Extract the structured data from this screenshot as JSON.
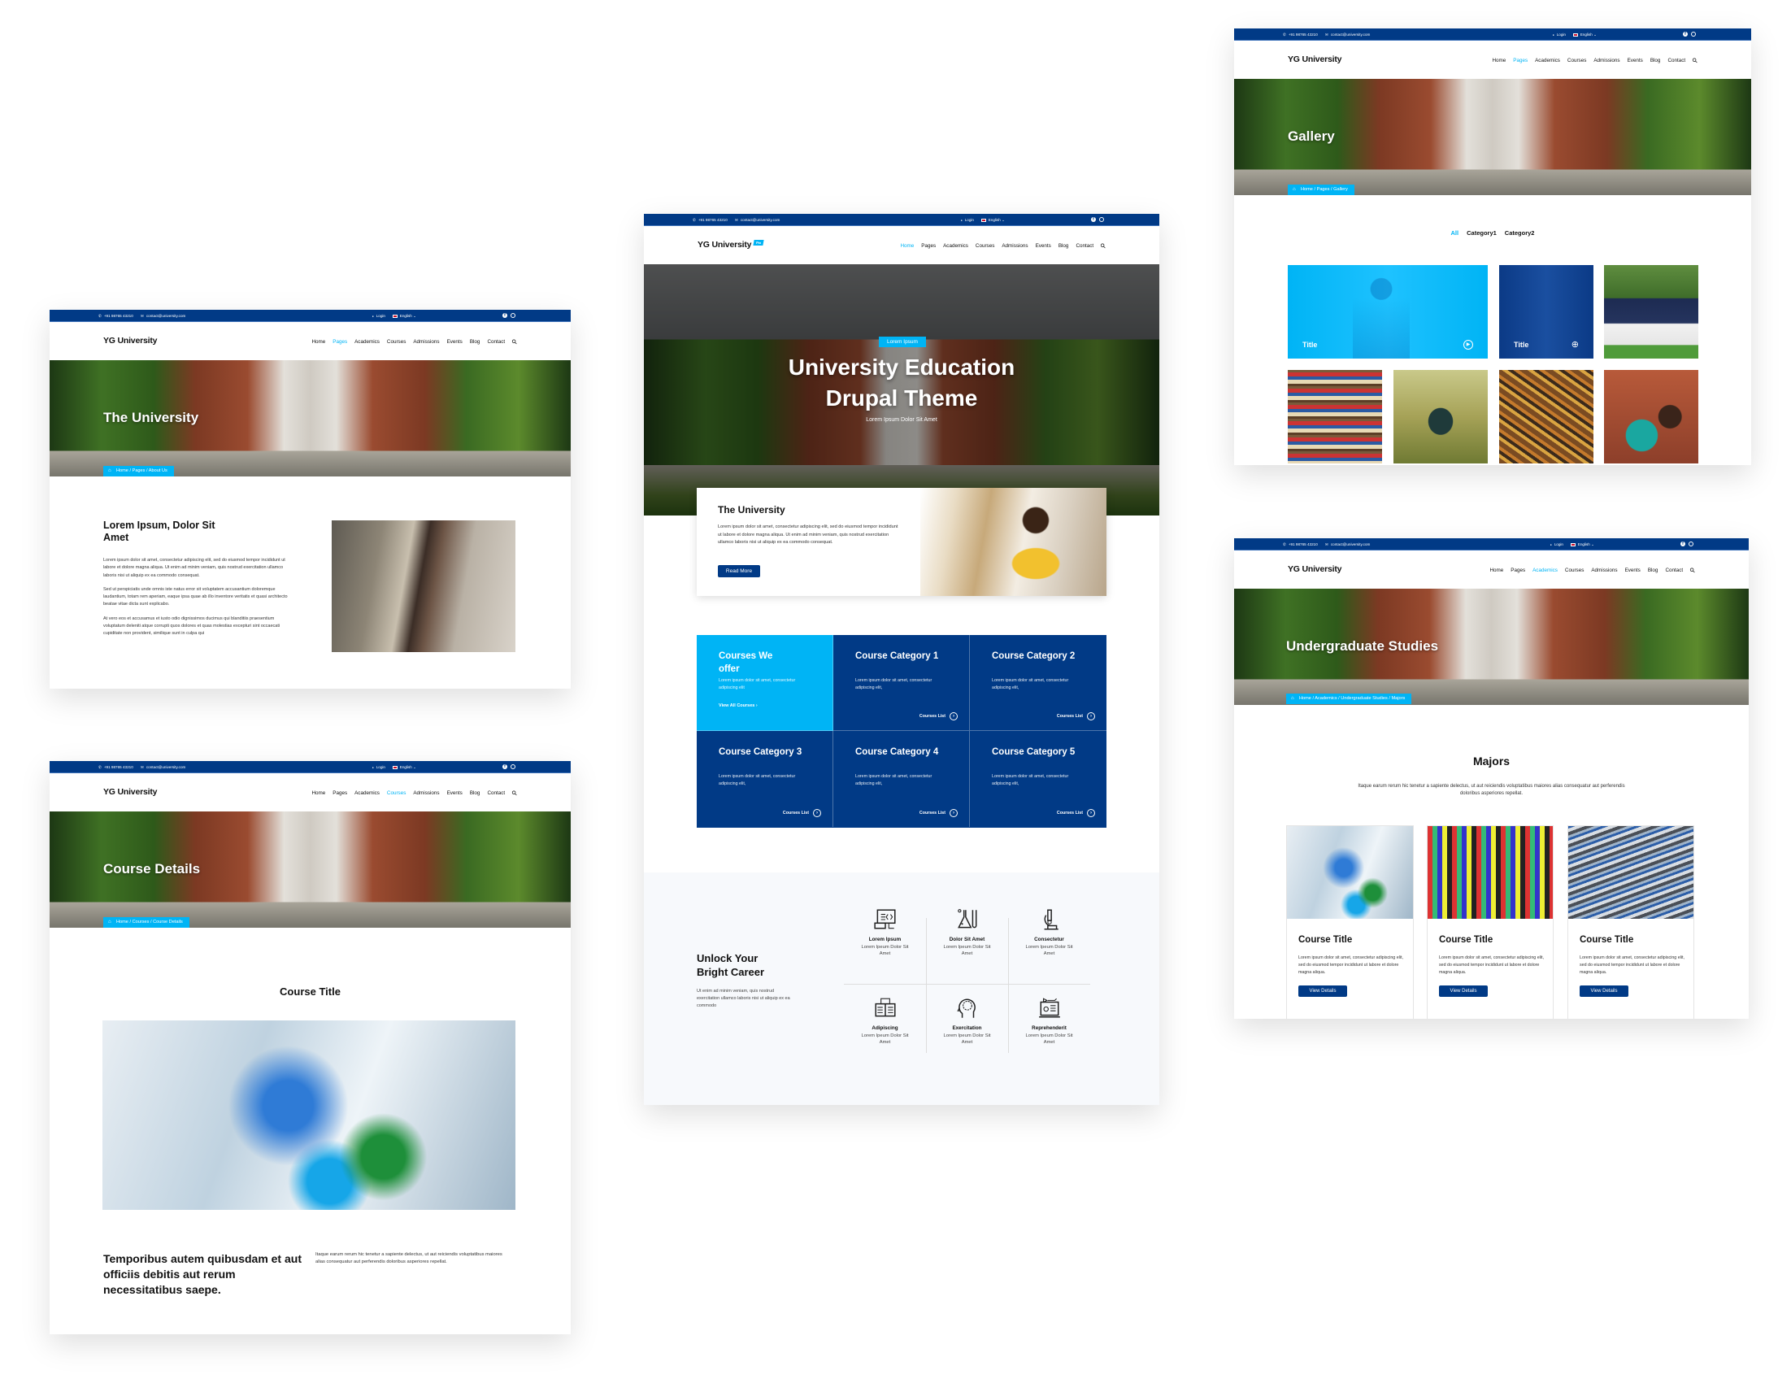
{
  "site": {
    "phone": "+91 98765 43210",
    "email": "contact@university.com",
    "login": "Login",
    "language": "English",
    "brand": "YG University",
    "nav": [
      "Home",
      "Pages",
      "Academics",
      "Courses",
      "Admissions",
      "Events",
      "Blog",
      "Contact"
    ],
    "colors": {
      "navy": "#013a86",
      "accent": "#00b4f5"
    }
  },
  "pages": {
    "about": {
      "active_nav": "Pages",
      "hero_title": "The University",
      "breadcrumb": "Home / Pages / About Us",
      "heading": "Lorem Ipsum, Dolor Sit Amet",
      "paragraphs": [
        "Lorem ipsum dolor sit amet, consectetur adipiscing elit, sed do eiusmod tempor incididunt ut labore et dolore magna aliqua. Ut enim ad minim veniam, quis nostrud exercitation ullamco laboris nisi ut aliquip ex ea commodo consequat.",
        "Sed ut perspiciatis unde omnis iste natus error sit voluptatem accusantium doloremque laudantium, totam rem aperiam, eaque ipsa quae ab illo inventore veritatis et quasi architecto beatae vitae dicta sunt explicabo.",
        "At vero eos et accusamus et iusto odio dignissimos ducimus qui blanditiis praesentium voluptatum deleniti atque corrupti quos dolores et quas molestias excepturi sint occaecati cupiditate non provident, similique sunt in culpa qui"
      ]
    },
    "course_details": {
      "active_nav": "Courses",
      "hero_title": "Course Details",
      "breadcrumb": "Home / Courses / Course Details",
      "section_title": "Course Title",
      "bottom_heading": "Temporibus autem quibusdam et aut officiis debitis aut rerum necessitatibus saepe.",
      "bottom_text": "Itaque earum rerum hic tenetur a sapiente delectus, ut aut reiciendis voluptatibus maiores alias consequatur aut perferendis doloribus asperiores repellat."
    },
    "home": {
      "active_nav": "Home",
      "brand_badge": "Pro",
      "hero_badge": "Lorem Ipsum",
      "hero_title_1": "University Education",
      "hero_title_2": "Drupal Theme",
      "hero_subtitle": "Lorem Ipsum Dolor Sit Amet",
      "card": {
        "title": "The University",
        "text": "Lorem ipsum dolor sit amet, consectetur adipiscing elit, sed do eiusmod tempor incididunt ut labore et dolore magna aliqua. Ut enim ad minim veniam, quis nostrud exercitation ullamco laboris nisi ut aliquip ex ea commodo consequat.",
        "button": "Read More"
      },
      "courses_intro": {
        "title": "Courses We offer",
        "text": "Lorem ipsum dolor sit amet, consectetur adipiscing elit",
        "link": "View All Courses"
      },
      "categories": [
        {
          "title": "Course Category 1",
          "text": "Lorem ipsum dolor sit amet, consectetur adipiscing elit,",
          "link": "Courses List"
        },
        {
          "title": "Course Category 2",
          "text": "Lorem ipsum dolor sit amet, consectetur adipiscing elit,",
          "link": "Courses List"
        },
        {
          "title": "Course Category 3",
          "text": "Lorem ipsum dolor sit amet, consectetur adipiscing elit,",
          "link": "Courses List"
        },
        {
          "title": "Course Category 4",
          "text": "Lorem ipsum dolor sit amet, consectetur adipiscing elit,",
          "link": "Courses List"
        },
        {
          "title": "Course Category 5",
          "text": "Lorem ipsum dolor sit amet, consectetur adipiscing elit,",
          "link": "Courses List"
        }
      ],
      "career": {
        "title": "Unlock Your Bright Career",
        "text": "Ut enim ad minim veniam, quis nostrud exercitation ullamco laboris nisi ut aliquip ex ea commodo",
        "items": [
          {
            "title": "Lorem Ipsum",
            "text": "Lorem Ipeum Dolor Sit Amet",
            "icon": "computer-code-icon"
          },
          {
            "title": "Dolor Sit Amet",
            "text": "Lorem Ipeum Dolor Sit Amet",
            "icon": "lab-flask-icon"
          },
          {
            "title": "Consectetur",
            "text": "Lorem Ipeum Dolor Sit Amet",
            "icon": "microscope-icon"
          },
          {
            "title": "Adipiscing",
            "text": "Lorem Ipeum Dolor Sit Amet",
            "icon": "open-book-icon"
          },
          {
            "title": "Exercitation",
            "text": "Lorem Ipeum Dolor Sit Amet",
            "icon": "brain-head-icon"
          },
          {
            "title": "Reprehenderit",
            "text": "Lorem Ipeum Dolor Sit Amet",
            "icon": "online-learning-icon"
          }
        ]
      }
    },
    "gallery": {
      "active_nav": "Pages",
      "hero_title": "Gallery",
      "breadcrumb": "Home / Pages / Gallery",
      "filters": [
        "All",
        "Category1",
        "Category2"
      ],
      "active_filter": "All",
      "tiles": [
        {
          "title": "Title",
          "icon": "play-icon"
        },
        {
          "title": "Title",
          "icon": "zoom-in-icon"
        }
      ]
    },
    "undergrad": {
      "active_nav": "Academics",
      "hero_title": "Undergraduate Studies",
      "breadcrumb": "Home / Academics / Undergraduate Studies / Majors",
      "title": "Majors",
      "description": "Itaque earum rerum hic tenetur a sapiente delectus, ut aut reiciendis voluptatibus maiores alias consequatur aut perferendis doloribus asperiores repellat.",
      "cards": [
        {
          "title": "Course Title",
          "text": "Lorem ipsum dolor sit amet, consectetur adipiscing elit, sed do eiusmod tempor incididunt ut labore et dolore magna aliqua.",
          "button": "View Details"
        },
        {
          "title": "Course Title",
          "text": "Lorem ipsum dolor sit amet, consectetur adipiscing elit, sed do eiusmod tempor incididunt ut labore et dolore magna aliqua.",
          "button": "View Details"
        },
        {
          "title": "Course Title",
          "text": "Lorem ipsum dolor sit amet, consectetur adipiscing elit, sed do eiusmod tempor incididunt ut labore et dolore magna aliqua.",
          "button": "View Details"
        }
      ]
    }
  }
}
